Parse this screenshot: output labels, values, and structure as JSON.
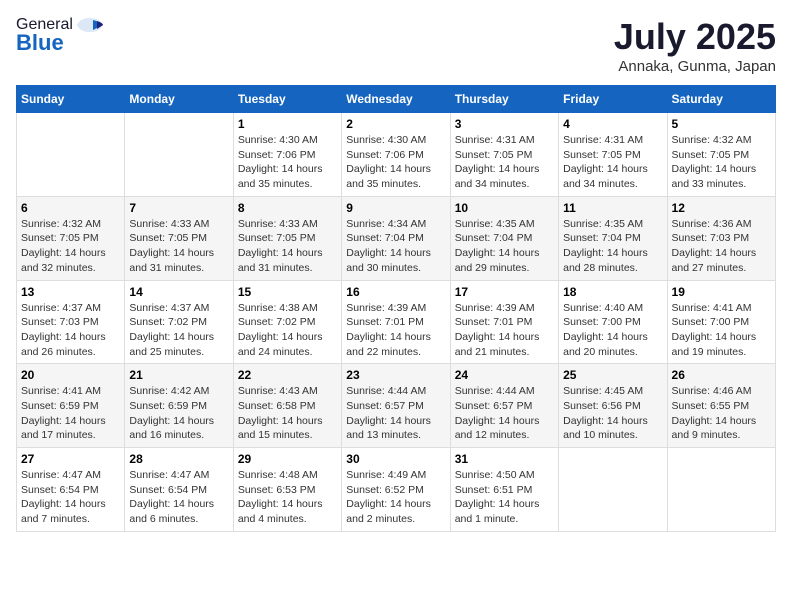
{
  "header": {
    "logo_general": "General",
    "logo_blue": "Blue",
    "month": "July 2025",
    "location": "Annaka, Gunma, Japan"
  },
  "weekdays": [
    "Sunday",
    "Monday",
    "Tuesday",
    "Wednesday",
    "Thursday",
    "Friday",
    "Saturday"
  ],
  "weeks": [
    [
      {
        "day": "",
        "sunrise": "",
        "sunset": "",
        "daylight": ""
      },
      {
        "day": "",
        "sunrise": "",
        "sunset": "",
        "daylight": ""
      },
      {
        "day": "1",
        "sunrise": "Sunrise: 4:30 AM",
        "sunset": "Sunset: 7:06 PM",
        "daylight": "Daylight: 14 hours and 35 minutes."
      },
      {
        "day": "2",
        "sunrise": "Sunrise: 4:30 AM",
        "sunset": "Sunset: 7:06 PM",
        "daylight": "Daylight: 14 hours and 35 minutes."
      },
      {
        "day": "3",
        "sunrise": "Sunrise: 4:31 AM",
        "sunset": "Sunset: 7:05 PM",
        "daylight": "Daylight: 14 hours and 34 minutes."
      },
      {
        "day": "4",
        "sunrise": "Sunrise: 4:31 AM",
        "sunset": "Sunset: 7:05 PM",
        "daylight": "Daylight: 14 hours and 34 minutes."
      },
      {
        "day": "5",
        "sunrise": "Sunrise: 4:32 AM",
        "sunset": "Sunset: 7:05 PM",
        "daylight": "Daylight: 14 hours and 33 minutes."
      }
    ],
    [
      {
        "day": "6",
        "sunrise": "Sunrise: 4:32 AM",
        "sunset": "Sunset: 7:05 PM",
        "daylight": "Daylight: 14 hours and 32 minutes."
      },
      {
        "day": "7",
        "sunrise": "Sunrise: 4:33 AM",
        "sunset": "Sunset: 7:05 PM",
        "daylight": "Daylight: 14 hours and 31 minutes."
      },
      {
        "day": "8",
        "sunrise": "Sunrise: 4:33 AM",
        "sunset": "Sunset: 7:05 PM",
        "daylight": "Daylight: 14 hours and 31 minutes."
      },
      {
        "day": "9",
        "sunrise": "Sunrise: 4:34 AM",
        "sunset": "Sunset: 7:04 PM",
        "daylight": "Daylight: 14 hours and 30 minutes."
      },
      {
        "day": "10",
        "sunrise": "Sunrise: 4:35 AM",
        "sunset": "Sunset: 7:04 PM",
        "daylight": "Daylight: 14 hours and 29 minutes."
      },
      {
        "day": "11",
        "sunrise": "Sunrise: 4:35 AM",
        "sunset": "Sunset: 7:04 PM",
        "daylight": "Daylight: 14 hours and 28 minutes."
      },
      {
        "day": "12",
        "sunrise": "Sunrise: 4:36 AM",
        "sunset": "Sunset: 7:03 PM",
        "daylight": "Daylight: 14 hours and 27 minutes."
      }
    ],
    [
      {
        "day": "13",
        "sunrise": "Sunrise: 4:37 AM",
        "sunset": "Sunset: 7:03 PM",
        "daylight": "Daylight: 14 hours and 26 minutes."
      },
      {
        "day": "14",
        "sunrise": "Sunrise: 4:37 AM",
        "sunset": "Sunset: 7:02 PM",
        "daylight": "Daylight: 14 hours and 25 minutes."
      },
      {
        "day": "15",
        "sunrise": "Sunrise: 4:38 AM",
        "sunset": "Sunset: 7:02 PM",
        "daylight": "Daylight: 14 hours and 24 minutes."
      },
      {
        "day": "16",
        "sunrise": "Sunrise: 4:39 AM",
        "sunset": "Sunset: 7:01 PM",
        "daylight": "Daylight: 14 hours and 22 minutes."
      },
      {
        "day": "17",
        "sunrise": "Sunrise: 4:39 AM",
        "sunset": "Sunset: 7:01 PM",
        "daylight": "Daylight: 14 hours and 21 minutes."
      },
      {
        "day": "18",
        "sunrise": "Sunrise: 4:40 AM",
        "sunset": "Sunset: 7:00 PM",
        "daylight": "Daylight: 14 hours and 20 minutes."
      },
      {
        "day": "19",
        "sunrise": "Sunrise: 4:41 AM",
        "sunset": "Sunset: 7:00 PM",
        "daylight": "Daylight: 14 hours and 19 minutes."
      }
    ],
    [
      {
        "day": "20",
        "sunrise": "Sunrise: 4:41 AM",
        "sunset": "Sunset: 6:59 PM",
        "daylight": "Daylight: 14 hours and 17 minutes."
      },
      {
        "day": "21",
        "sunrise": "Sunrise: 4:42 AM",
        "sunset": "Sunset: 6:59 PM",
        "daylight": "Daylight: 14 hours and 16 minutes."
      },
      {
        "day": "22",
        "sunrise": "Sunrise: 4:43 AM",
        "sunset": "Sunset: 6:58 PM",
        "daylight": "Daylight: 14 hours and 15 minutes."
      },
      {
        "day": "23",
        "sunrise": "Sunrise: 4:44 AM",
        "sunset": "Sunset: 6:57 PM",
        "daylight": "Daylight: 14 hours and 13 minutes."
      },
      {
        "day": "24",
        "sunrise": "Sunrise: 4:44 AM",
        "sunset": "Sunset: 6:57 PM",
        "daylight": "Daylight: 14 hours and 12 minutes."
      },
      {
        "day": "25",
        "sunrise": "Sunrise: 4:45 AM",
        "sunset": "Sunset: 6:56 PM",
        "daylight": "Daylight: 14 hours and 10 minutes."
      },
      {
        "day": "26",
        "sunrise": "Sunrise: 4:46 AM",
        "sunset": "Sunset: 6:55 PM",
        "daylight": "Daylight: 14 hours and 9 minutes."
      }
    ],
    [
      {
        "day": "27",
        "sunrise": "Sunrise: 4:47 AM",
        "sunset": "Sunset: 6:54 PM",
        "daylight": "Daylight: 14 hours and 7 minutes."
      },
      {
        "day": "28",
        "sunrise": "Sunrise: 4:47 AM",
        "sunset": "Sunset: 6:54 PM",
        "daylight": "Daylight: 14 hours and 6 minutes."
      },
      {
        "day": "29",
        "sunrise": "Sunrise: 4:48 AM",
        "sunset": "Sunset: 6:53 PM",
        "daylight": "Daylight: 14 hours and 4 minutes."
      },
      {
        "day": "30",
        "sunrise": "Sunrise: 4:49 AM",
        "sunset": "Sunset: 6:52 PM",
        "daylight": "Daylight: 14 hours and 2 minutes."
      },
      {
        "day": "31",
        "sunrise": "Sunrise: 4:50 AM",
        "sunset": "Sunset: 6:51 PM",
        "daylight": "Daylight: 14 hours and 1 minute."
      },
      {
        "day": "",
        "sunrise": "",
        "sunset": "",
        "daylight": ""
      },
      {
        "day": "",
        "sunrise": "",
        "sunset": "",
        "daylight": ""
      }
    ]
  ]
}
